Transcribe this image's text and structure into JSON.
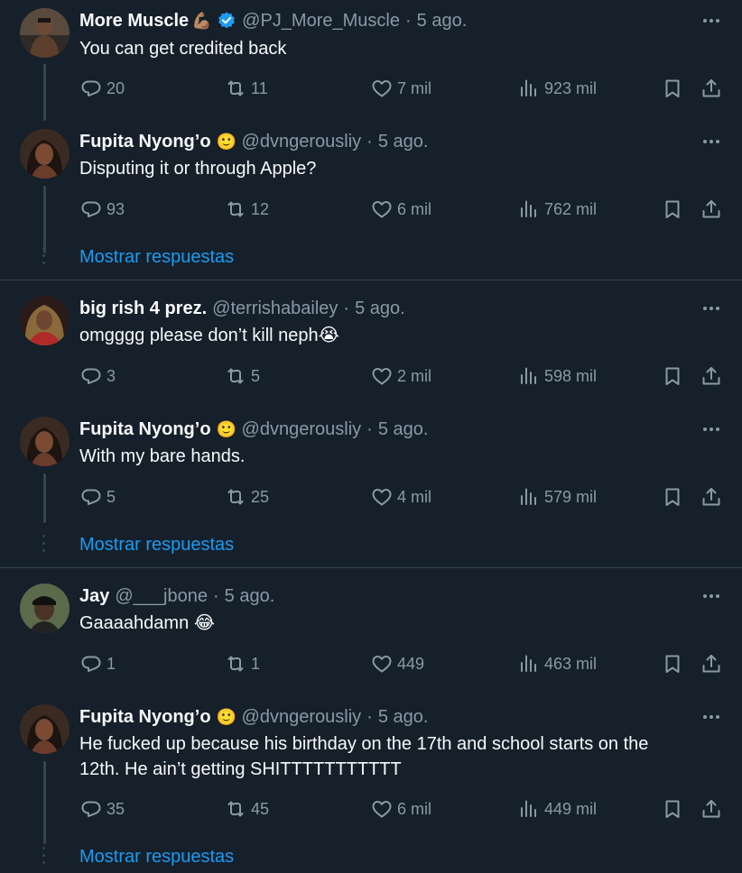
{
  "icons": {
    "more": "more-icon",
    "reply": "reply-icon",
    "retweet": "retweet-icon",
    "like": "like-icon",
    "views": "views-icon",
    "bookmark": "bookmark-icon",
    "share": "share-icon",
    "verified": "verified-badge-icon"
  },
  "colors": {
    "background": "#15202b",
    "link": "#1d9bf0",
    "muted": "#8b98a5",
    "verified": "#1d9bf0",
    "line": "#38444d"
  },
  "threads": [
    {
      "tweets": [
        {
          "name": "More Muscle",
          "name_emoji": "💪🏽",
          "verified": true,
          "handle": "@PJ_More_Muscle",
          "separator": "·",
          "time": "5 ago.",
          "text": "You can get credited back",
          "stats": {
            "replies": "20",
            "retweets": "11",
            "likes": "7 mil",
            "views": "923 mil"
          }
        },
        {
          "name": "Fupita Nyong’o",
          "name_emoji": "🙂",
          "handle": "@dvngerousliy",
          "separator": "·",
          "time": "5 ago.",
          "text": "Disputing it or through Apple?",
          "stats": {
            "replies": "93",
            "retweets": "12",
            "likes": "6 mil",
            "views": "762 mil"
          }
        }
      ],
      "show_replies": "Mostrar respuestas"
    },
    {
      "tweets": [
        {
          "name": "big rish 4 prez.",
          "handle": "@terrishabailey",
          "separator": "·",
          "time": "5 ago.",
          "text": "omgggg please don’t kill neph",
          "text_emoji": "😭",
          "stats": {
            "replies": "3",
            "retweets": "5",
            "likes": "2 mil",
            "views": "598 mil"
          }
        },
        {
          "name": "Fupita Nyong’o",
          "name_emoji": "🙂",
          "handle": "@dvngerousliy",
          "separator": "·",
          "time": "5 ago.",
          "text": "With my bare hands.",
          "stats": {
            "replies": "5",
            "retweets": "25",
            "likes": "4 mil",
            "views": "579 mil"
          }
        }
      ],
      "show_replies": "Mostrar respuestas"
    },
    {
      "tweets": [
        {
          "name": "Jay",
          "handle": "@___jbone",
          "separator": "·",
          "time": "5 ago.",
          "text": "Gaaaahdamn",
          "text_emoji": "😂",
          "stats": {
            "replies": "1",
            "retweets": "1",
            "likes": "449",
            "views": "463 mil"
          }
        },
        {
          "name": "Fupita Nyong’o",
          "name_emoji": "🙂",
          "handle": "@dvngerousliy",
          "separator": "·",
          "time": "5 ago.",
          "text_line1": "He fucked up because his birthday on the 17th and school starts on the",
          "text_line2": "12th. He ain’t getting SHITTTTTTTTTTT",
          "stats": {
            "replies": "35",
            "retweets": "45",
            "likes": "6 mil",
            "views": "449 mil"
          }
        }
      ],
      "show_replies": "Mostrar respuestas"
    }
  ]
}
